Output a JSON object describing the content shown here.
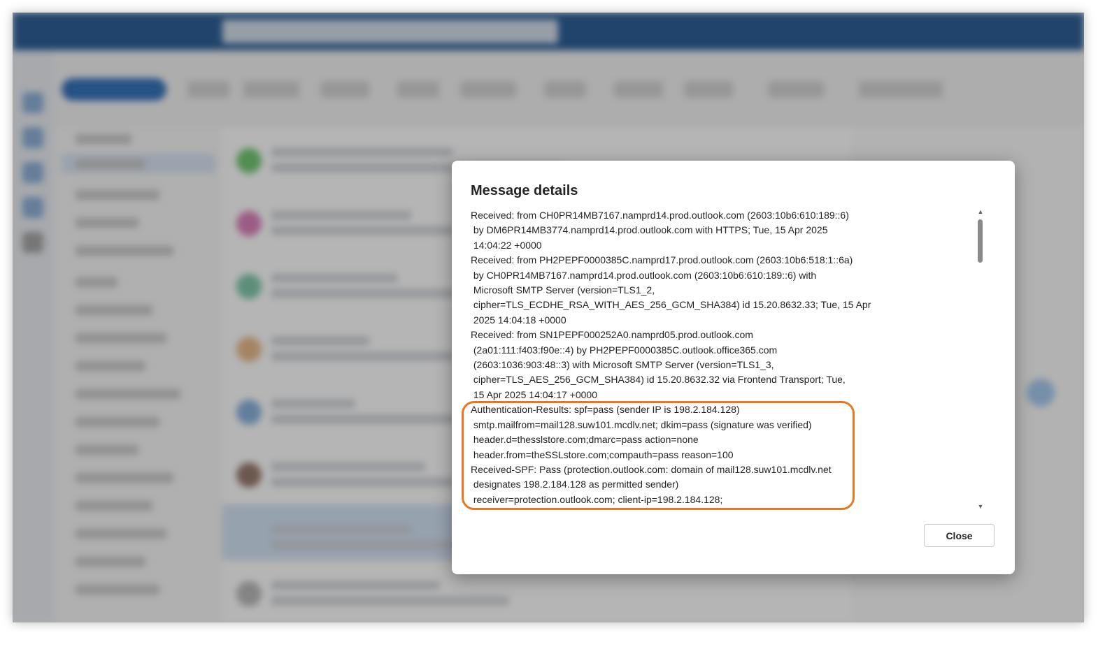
{
  "dialog": {
    "title": "Message details",
    "close_label": "Close",
    "header_lines": [
      "Received: from CH0PR14MB7167.namprd14.prod.outlook.com (2603:10b6:610:189::6)",
      " by DM6PR14MB3774.namprd14.prod.outlook.com with HTTPS; Tue, 15 Apr 2025",
      " 14:04:22 +0000",
      "Received: from PH2PEPF0000385C.namprd17.prod.outlook.com (2603:10b6:518:1::6a)",
      " by CH0PR14MB7167.namprd14.prod.outlook.com (2603:10b6:610:189::6) with",
      " Microsoft SMTP Server (version=TLS1_2,",
      " cipher=TLS_ECDHE_RSA_WITH_AES_256_GCM_SHA384) id 15.20.8632.33; Tue, 15 Apr",
      " 2025 14:04:18 +0000",
      "Received: from SN1PEPF000252A0.namprd05.prod.outlook.com",
      " (2a01:111:f403:f90e::4) by PH2PEPF0000385C.outlook.office365.com",
      " (2603:1036:903:48::3) with Microsoft SMTP Server (version=TLS1_3,",
      " cipher=TLS_AES_256_GCM_SHA384) id 15.20.8632.32 via Frontend Transport; Tue,",
      " 15 Apr 2025 14:04:17 +0000",
      "Authentication-Results: spf=pass (sender IP is 198.2.184.128)",
      " smtp.mailfrom=mail128.suw101.mcdlv.net; dkim=pass (signature was verified)",
      " header.d=thesslstore.com;dmarc=pass action=none",
      " header.from=theSSLstore.com;compauth=pass reason=100",
      "Received-SPF: Pass (protection.outlook.com: domain of mail128.suw101.mcdlv.net",
      " designates 198.2.184.128 as permitted sender)",
      " receiver=protection.outlook.com; client-ip=198.2.184.128;"
    ]
  },
  "colors": {
    "highlight": "#e87722",
    "titlebar": "#0f4a8a"
  }
}
